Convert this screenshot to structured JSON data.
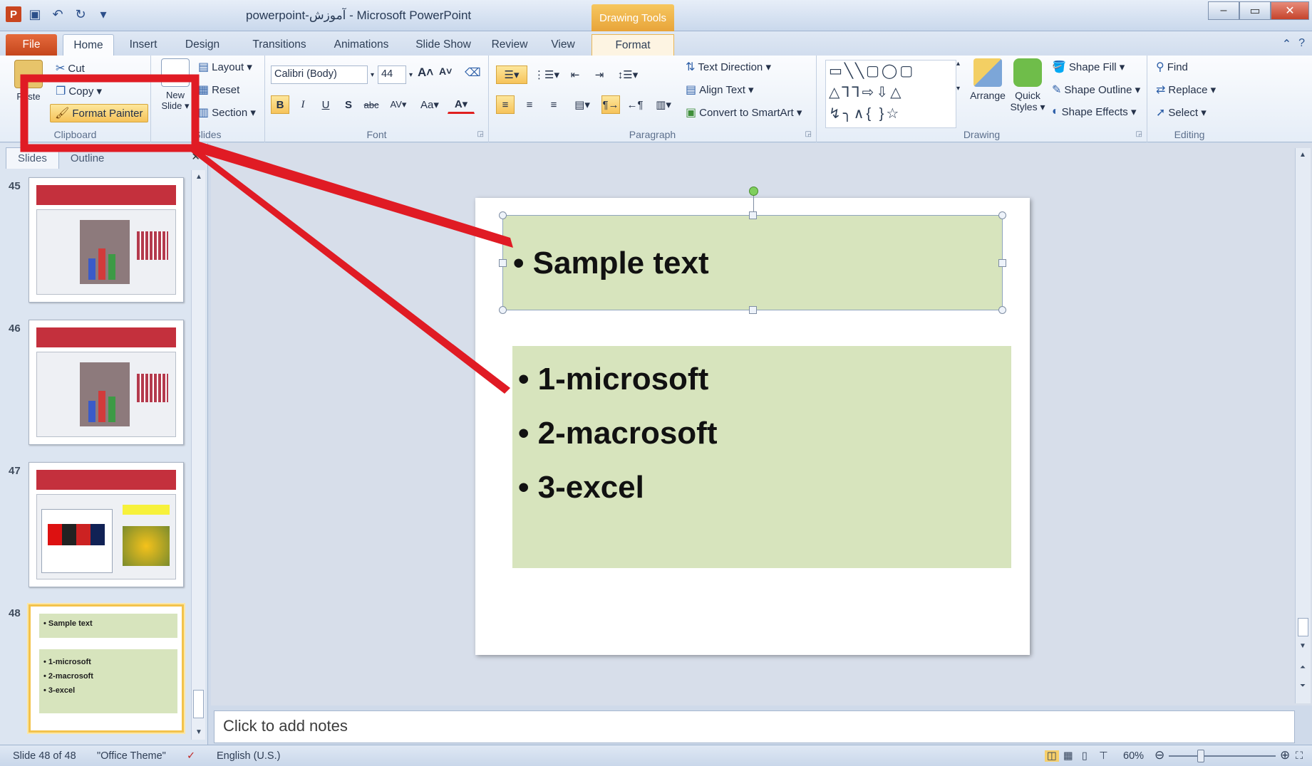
{
  "window": {
    "title": "powerpoint-آموزش - Microsoft PowerPoint",
    "contextual_tab_group": "Drawing Tools",
    "minimize": "–",
    "restore": "▭",
    "close": "✕"
  },
  "tabs": [
    "File",
    "Home",
    "Insert",
    "Design",
    "Transitions",
    "Animations",
    "Slide Show",
    "Review",
    "View",
    "Format"
  ],
  "ribbon": {
    "clipboard": {
      "paste": "Paste",
      "cut": "Cut",
      "copy": "Copy ▾",
      "format_painter": "Format Painter",
      "label": "Clipboard"
    },
    "slides": {
      "new_slide": "New Slide ▾",
      "layout": "Layout ▾",
      "reset": "Reset",
      "section": "Section ▾",
      "label": "Slides"
    },
    "font": {
      "font_name": "Calibri (Body)",
      "font_size": "44",
      "bold": "B",
      "italic": "I",
      "underline": "U",
      "shadow": "S",
      "strike": "abc",
      "spacing": "AV▾",
      "case": "Aa▾",
      "color": "A▾",
      "grow": "A˄",
      "shrink": "A˅",
      "label": "Font"
    },
    "paragraph": {
      "text_direction": "Text Direction ▾",
      "align_text": "Align Text ▾",
      "convert_smartart": "Convert to SmartArt ▾",
      "label": "Paragraph"
    },
    "drawing": {
      "arrange": "Arrange",
      "quick_styles": "Quick Styles ▾",
      "shape_fill": "Shape Fill ▾",
      "shape_outline": "Shape Outline ▾",
      "shape_effects": "Shape Effects ▾",
      "label": "Drawing"
    },
    "editing": {
      "find": "Find",
      "replace": "Replace ▾",
      "select": "Select ▾",
      "label": "Editing"
    }
  },
  "pane": {
    "tab_slides": "Slides",
    "tab_outline": "Outline",
    "close": "✕",
    "thumbnails": [
      {
        "number": "45"
      },
      {
        "number": "46"
      },
      {
        "number": "47"
      },
      {
        "number": "48",
        "title": "• Sample text",
        "items": [
          "• 1-microsoft",
          "• 2-macrosoft",
          "• 3-excel"
        ]
      }
    ]
  },
  "slide": {
    "title": "• Sample text",
    "bullets": [
      "• 1-microsoft",
      "• 2-macrosoft",
      "• 3-excel"
    ]
  },
  "notes_placeholder": "Click to add notes",
  "status": {
    "slide_counter": "Slide 48 of 48",
    "theme": "\"Office Theme\"",
    "language": "English (U.S.)",
    "zoom": "60%"
  },
  "colors": {
    "annotation_red": "#e01b24",
    "placeholder_fill": "#d7e4bd",
    "file_tab": "#d2522a",
    "thumb_banner": "#c4303d"
  }
}
